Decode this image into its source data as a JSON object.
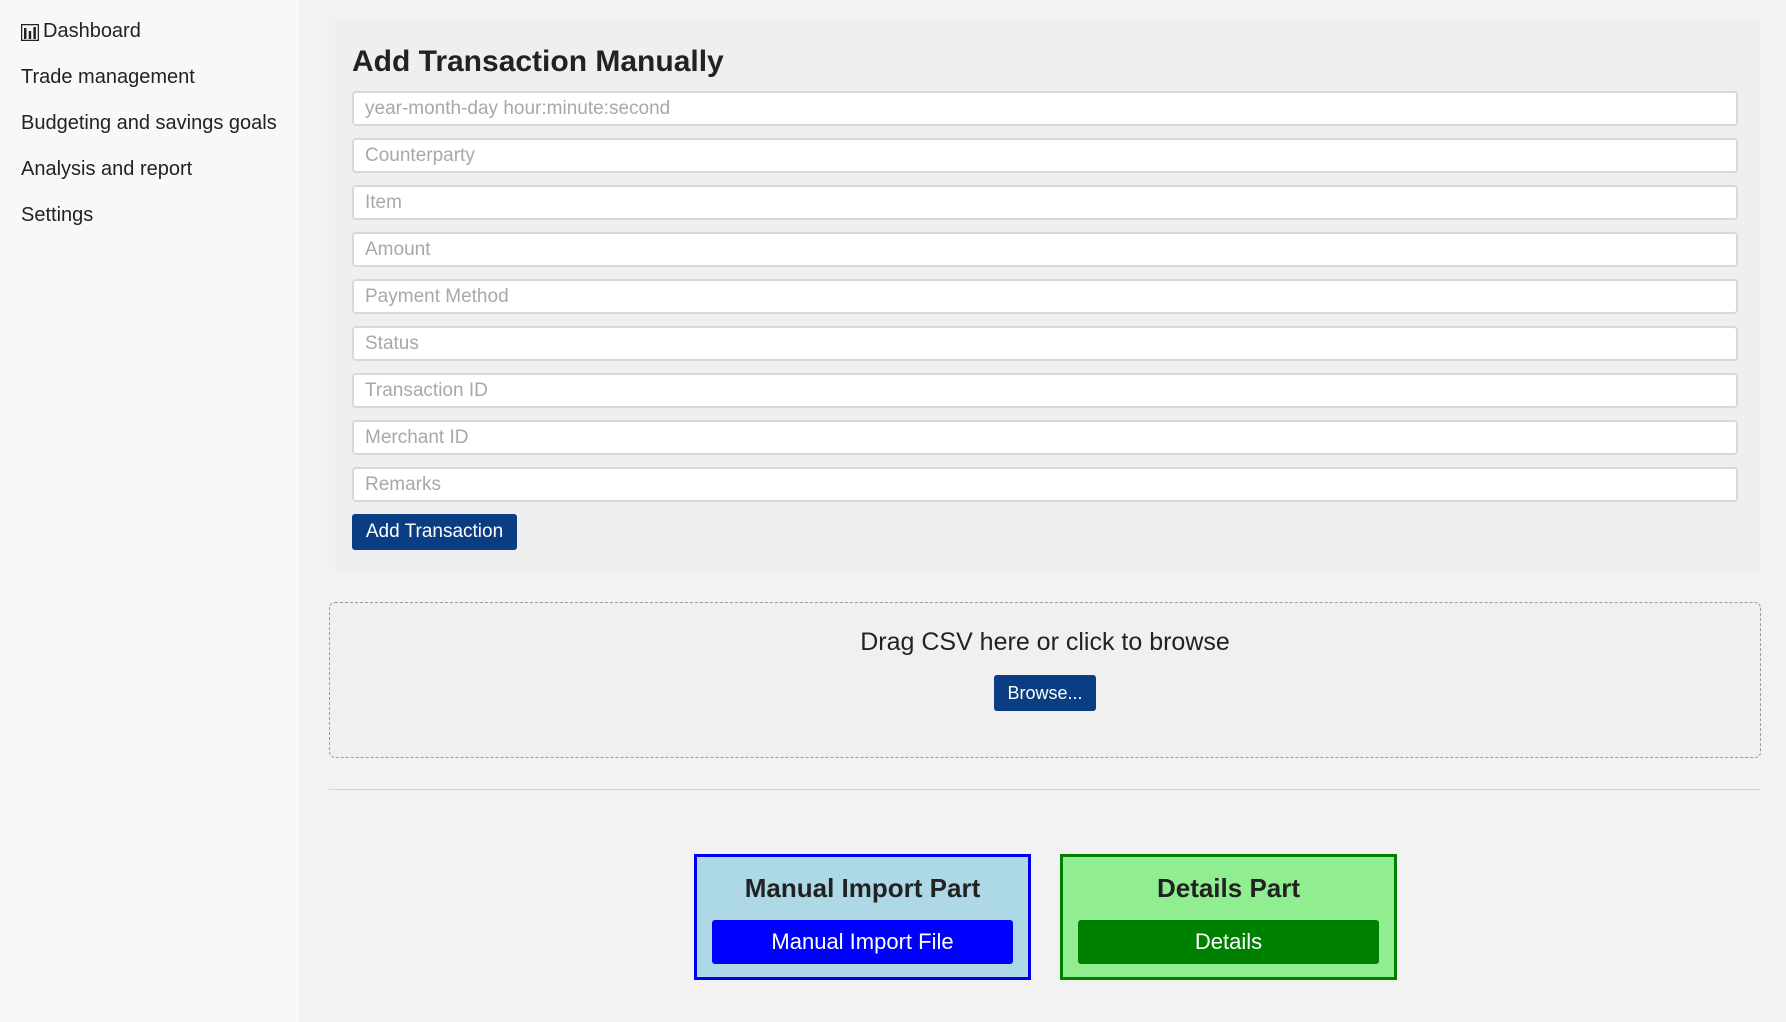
{
  "sidebar": {
    "items": [
      {
        "label": "Dashboard",
        "icon": "bar-chart-icon"
      },
      {
        "label": "Trade management"
      },
      {
        "label": "Budgeting and savings goals"
      },
      {
        "label": "Analysis and report"
      },
      {
        "label": "Settings"
      }
    ]
  },
  "manual_form": {
    "title": "Add Transaction Manually",
    "fields": [
      {
        "placeholder": "year-month-day hour:minute:second",
        "value": ""
      },
      {
        "placeholder": "Counterparty",
        "value": ""
      },
      {
        "placeholder": "Item",
        "value": ""
      },
      {
        "placeholder": "Amount",
        "value": ""
      },
      {
        "placeholder": "Payment Method",
        "value": ""
      },
      {
        "placeholder": "Status",
        "value": ""
      },
      {
        "placeholder": "Transaction ID",
        "value": ""
      },
      {
        "placeholder": "Merchant ID",
        "value": ""
      },
      {
        "placeholder": "Remarks",
        "value": ""
      }
    ],
    "submit_label": "Add Transaction"
  },
  "dropzone": {
    "text": "Drag CSV here or click to browse",
    "browse_label": "Browse..."
  },
  "cards": {
    "manual": {
      "title": "Manual Import Part",
      "button_label": "Manual Import File"
    },
    "details": {
      "title": "Details Part",
      "button_label": "Details"
    }
  },
  "colors": {
    "primary_button": "#0b3d82",
    "manual_card_bg": "#add8e6",
    "manual_card_border": "#0000ee",
    "manual_button": "#0000ff",
    "details_card_bg": "#90ee90",
    "details_card_border": "#008000",
    "details_button": "#008000"
  }
}
